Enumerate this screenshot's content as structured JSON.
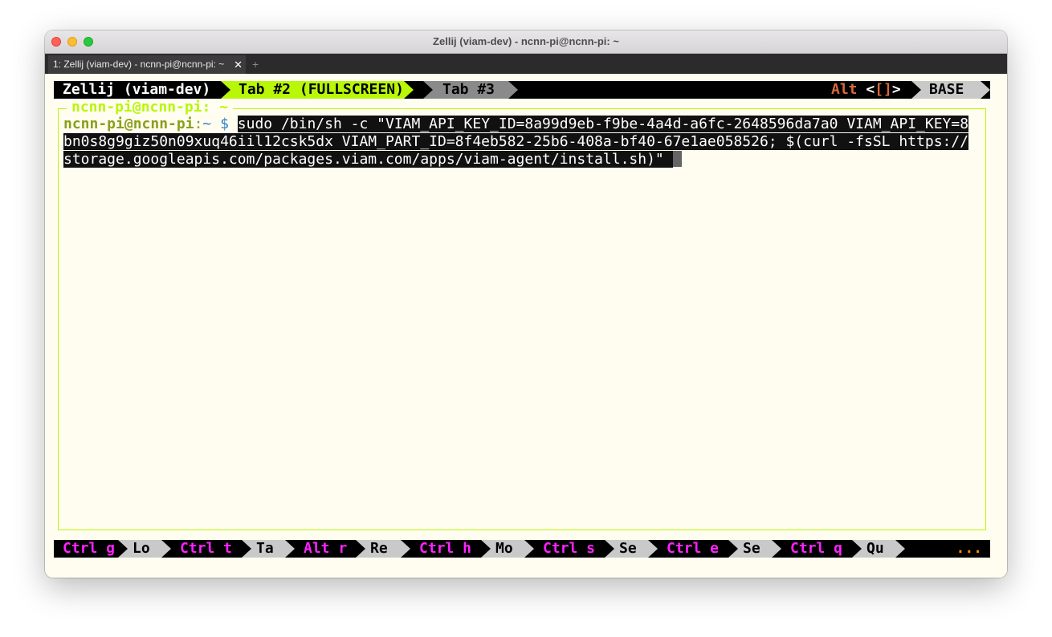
{
  "window": {
    "title": "Zellij (viam-dev) - ncnn-pi@ncnn-pi: ~"
  },
  "os_tabs": {
    "active_label": "1: Zellij (viam-dev) - ncnn-pi@ncnn-pi: ~",
    "close_glyph": "✕",
    "new_tab_glyph": "+"
  },
  "zellij": {
    "session": "Zellij (viam-dev)",
    "tabs": [
      {
        "label": "Tab #2 (FULLSCREEN)",
        "active": true
      },
      {
        "label": "Tab #3",
        "active": false
      }
    ],
    "mode_hint": {
      "alt": "Alt",
      "open": "<",
      "brackets": "[]",
      "close": ">"
    },
    "mode": "BASE"
  },
  "pane": {
    "title": "ncnn-pi@ncnn-pi: ~",
    "prompt": {
      "user_host": "ncnn-pi@ncnn-pi",
      "colon": ":",
      "path": "~",
      "dollar": " $ "
    },
    "command_lines": [
      "sudo /bin/sh -c \"VIAM_API_KEY_ID=8a99d9eb-f9be-4a4d-a6fc-2648596da7a0 VIAM_API_KEY=8",
      "bn0s8g9giz50n09xuq46iil12csk5dx VIAM_PART_ID=8f4eb582-25b6-408a-bf40-67e1ae058526; $(curl -fsSL https://",
      "storage.googleapis.com/packages.viam.com/apps/viam-agent/install.sh)\" "
    ]
  },
  "statusbar": {
    "items": [
      {
        "key": "Ctrl g",
        "action": "Lo"
      },
      {
        "key": "Ctrl t",
        "action": "Ta"
      },
      {
        "key": "Alt r",
        "action": "Re"
      },
      {
        "key": "Ctrl h",
        "action": "Mo"
      },
      {
        "key": "Ctrl s",
        "action": "Se"
      },
      {
        "key": "Ctrl e",
        "action": "Se"
      },
      {
        "key": "Ctrl q",
        "action": "Qu"
      }
    ],
    "more": "..."
  },
  "colors": {
    "accent": "#b8f707",
    "key_magenta": "#ff22ff",
    "alt_orange": "#d9683a",
    "terminal_bg": "#fffdf0"
  }
}
